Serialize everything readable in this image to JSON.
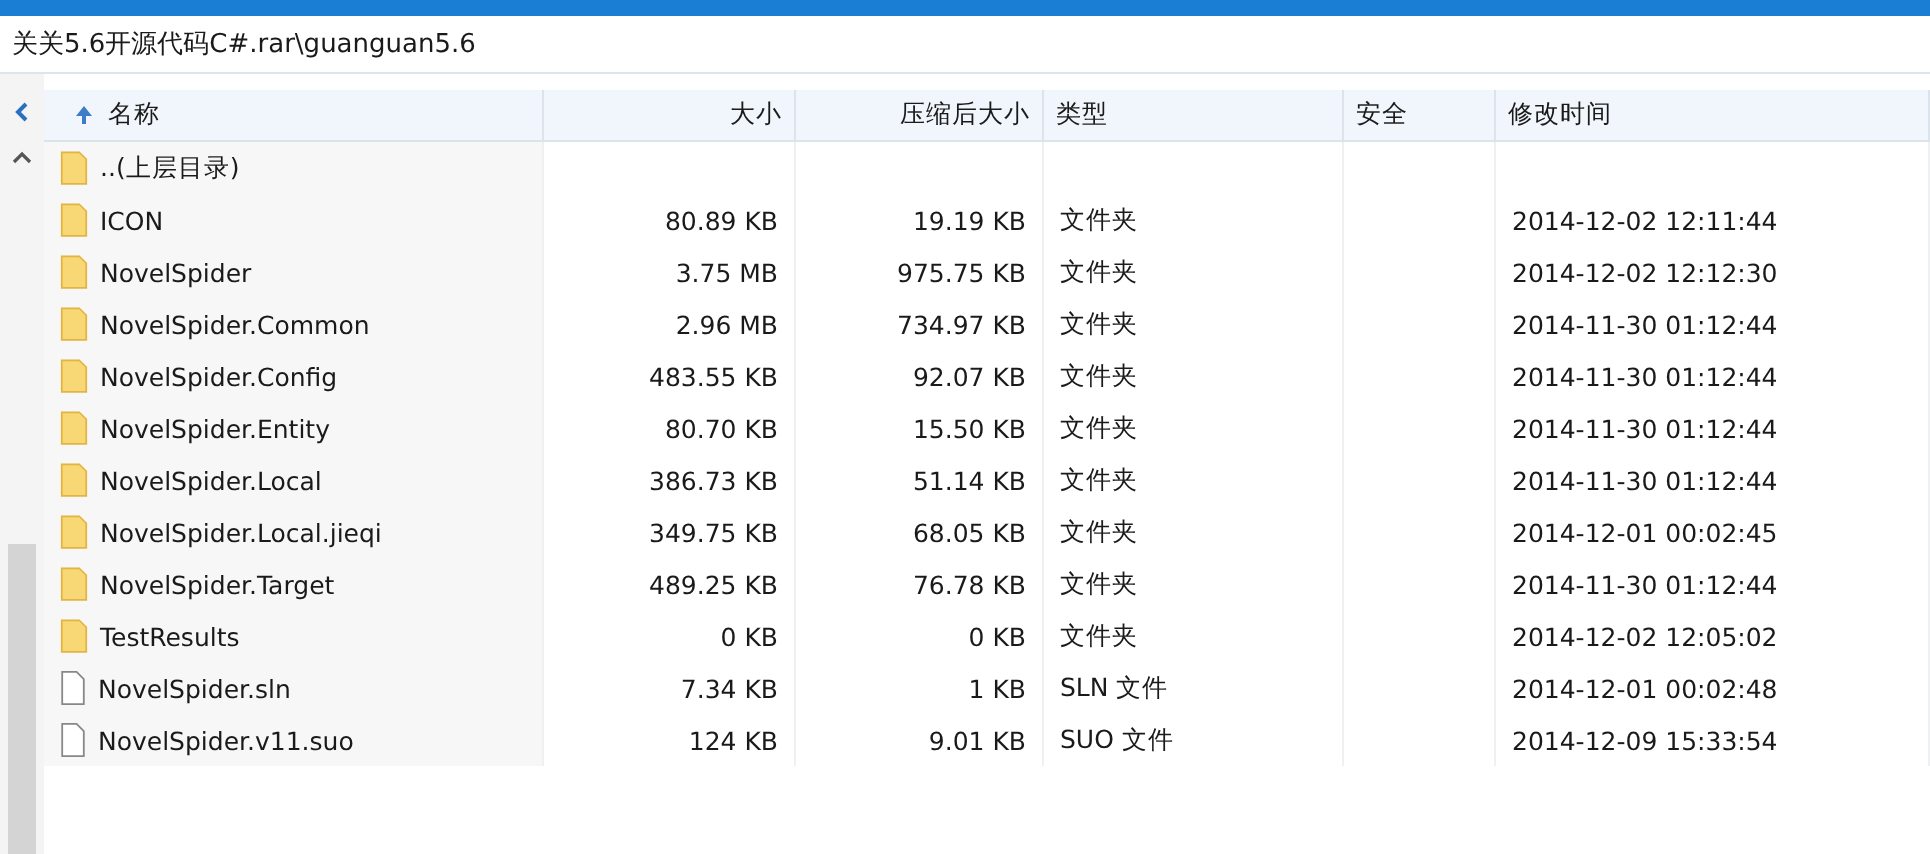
{
  "address_bar": {
    "path": "关关5.6开源代码C#.rar\\guanguan5.6"
  },
  "table": {
    "columns": [
      {
        "label": "名称",
        "sorted": true
      },
      {
        "label": "大小",
        "sorted": false
      },
      {
        "label": "压缩后大小",
        "sorted": false
      },
      {
        "label": "类型",
        "sorted": false
      },
      {
        "label": "安全",
        "sorted": false
      },
      {
        "label": "修改时间",
        "sorted": false
      }
    ],
    "rows": [
      {
        "kind": "folder",
        "name": "..(上层目录)"
      },
      {
        "kind": "folder",
        "name": "ICON",
        "size": "80.89 KB",
        "packed": "19.19 KB",
        "type": "文件夹",
        "modified": "2014-12-02 12:11:44"
      },
      {
        "kind": "folder",
        "name": "NovelSpider",
        "size": "3.75 MB",
        "packed": "975.75 KB",
        "type": "文件夹",
        "modified": "2014-12-02 12:12:30"
      },
      {
        "kind": "folder",
        "name": "NovelSpider.Common",
        "size": "2.96 MB",
        "packed": "734.97 KB",
        "type": "文件夹",
        "modified": "2014-11-30 01:12:44"
      },
      {
        "kind": "folder",
        "name": "NovelSpider.Config",
        "size": "483.55 KB",
        "packed": "92.07 KB",
        "type": "文件夹",
        "modified": "2014-11-30 01:12:44"
      },
      {
        "kind": "folder",
        "name": "NovelSpider.Entity",
        "size": "80.70 KB",
        "packed": "15.50 KB",
        "type": "文件夹",
        "modified": "2014-11-30 01:12:44"
      },
      {
        "kind": "folder",
        "name": "NovelSpider.Local",
        "size": "386.73 KB",
        "packed": "51.14 KB",
        "type": "文件夹",
        "modified": "2014-11-30 01:12:44"
      },
      {
        "kind": "folder",
        "name": "NovelSpider.Local.jieqi",
        "size": "349.75 KB",
        "packed": "68.05 KB",
        "type": "文件夹",
        "modified": "2014-12-01 00:02:45"
      },
      {
        "kind": "folder",
        "name": "NovelSpider.Target",
        "size": "489.25 KB",
        "packed": "76.78 KB",
        "type": "文件夹",
        "modified": "2014-11-30 01:12:44"
      },
      {
        "kind": "folder",
        "name": "TestResults",
        "size": "0 KB",
        "packed": "0 KB",
        "type": "文件夹",
        "modified": "2014-12-02 12:05:02"
      },
      {
        "kind": "file",
        "name": "NovelSpider.sln",
        "size": "7.34 KB",
        "packed": "1 KB",
        "type": "SLN 文件",
        "modified": "2014-12-01 00:02:48"
      },
      {
        "kind": "file",
        "name": "NovelSpider.v11.suo",
        "size": "124 KB",
        "packed": "9.01 KB",
        "type": "SUO 文件",
        "modified": "2014-12-09 15:33:54"
      }
    ]
  }
}
